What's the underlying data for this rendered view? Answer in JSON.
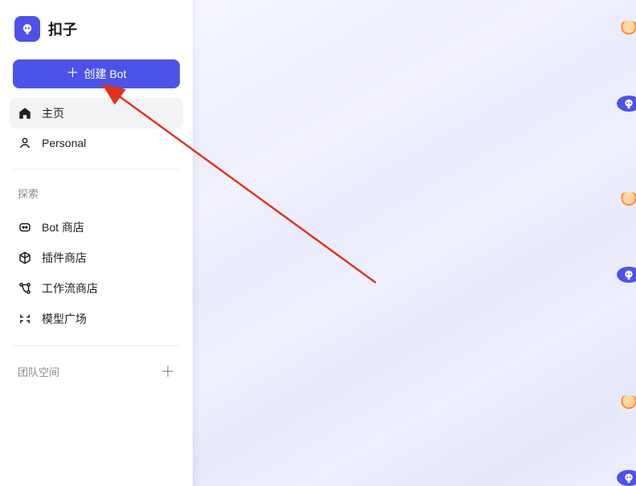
{
  "brand": {
    "name": "扣子"
  },
  "create_button": {
    "label": "创建 Bot"
  },
  "nav": {
    "home": "主页",
    "personal": "Personal"
  },
  "explore": {
    "label": "探索",
    "items": {
      "bot_store": "Bot 商店",
      "plugin_store": "插件商店",
      "workflow_store": "工作流商店",
      "model_playground": "模型广场"
    }
  },
  "team": {
    "label": "团队空间"
  },
  "colors": {
    "accent": "#4D53E8",
    "arrow": "#E2311D"
  },
  "avatars": [
    {
      "kind": "balloon"
    },
    {
      "kind": "coze"
    },
    {
      "kind": "balloon"
    },
    {
      "kind": "coze"
    },
    {
      "kind": "balloon"
    },
    {
      "kind": "coze"
    }
  ]
}
